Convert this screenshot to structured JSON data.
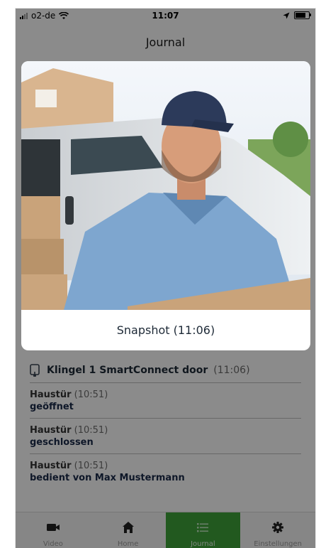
{
  "status_bar": {
    "carrier": "o2-de",
    "time": "11:07"
  },
  "header": {
    "title": "Journal"
  },
  "modal": {
    "caption": "Snapshot (11:06)"
  },
  "journal": {
    "bell_entry": {
      "name": "Klingel 1 SmartConnect door",
      "time": "(11:06)",
      "icon": "doorbell-icon"
    },
    "entries": [
      {
        "title": "Haustür",
        "time": "(10:51)",
        "status": "geöffnet"
      },
      {
        "title": "Haustür",
        "time": "(10:51)",
        "status": "geschlossen"
      },
      {
        "title": "Haustür",
        "time": "(10:51)",
        "status": "bedient von Max Mustermann"
      }
    ]
  },
  "tabs": [
    {
      "label": "Video",
      "icon": "video-camera-icon"
    },
    {
      "label": "Home",
      "icon": "home-icon"
    },
    {
      "label": "Journal",
      "icon": "list-icon",
      "active": true
    },
    {
      "label": "Einstellungen",
      "icon": "gear-icon"
    }
  ],
  "colors": {
    "accent": "#3ea23a",
    "overlay": "rgba(0,0,0,0.45)"
  }
}
